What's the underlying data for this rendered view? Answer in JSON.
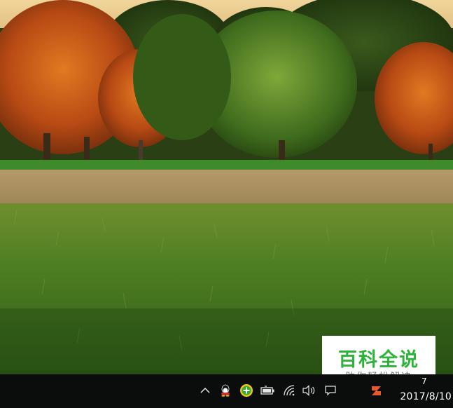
{
  "desktop": {
    "wallpaper_icon": "autumn-meadow-wallpaper"
  },
  "watermark": {
    "title": "百科全说",
    "subtitle": "助你轻松解决",
    "title_color": "#2db33a",
    "subtitle_color": "#7a7a7a"
  },
  "taskbar": {
    "background": "#0b0d0c",
    "tray_icons": [
      {
        "name": "chevron-up-icon",
        "glyph": "︿"
      },
      {
        "name": "qq-icon"
      },
      {
        "name": "add-plus-icon"
      },
      {
        "name": "battery-icon"
      },
      {
        "name": "wifi-icon"
      },
      {
        "name": "speaker-icon",
        "glyph": "🔈"
      },
      {
        "name": "notification-icon"
      },
      {
        "name": "ime-icon"
      }
    ],
    "clock": {
      "time": "7",
      "date": "2017/8/10"
    }
  }
}
